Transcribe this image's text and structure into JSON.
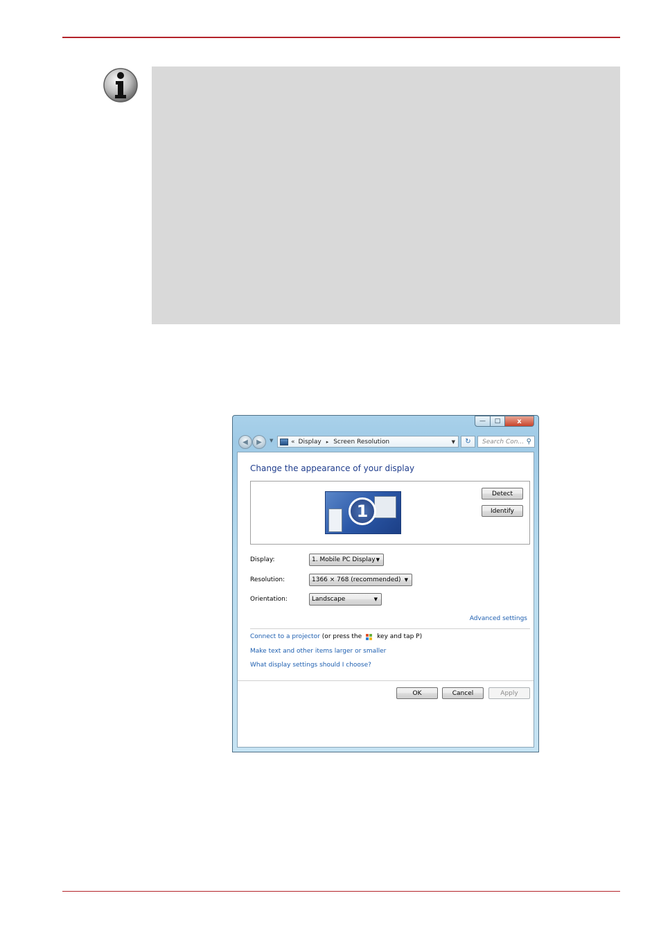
{
  "window": {
    "caption_buttons": {
      "minimize": "—",
      "maximize": "□",
      "close": "x"
    },
    "breadcrumb": {
      "overflow": "«",
      "item1": "Display",
      "separator": "▸",
      "item2": "Screen Resolution"
    },
    "search": {
      "placeholder": "Search Con..."
    }
  },
  "main": {
    "heading": "Change the appearance of your display",
    "monitor_number": "1",
    "detect_label": "Detect",
    "identify_label": "Identify",
    "display_label": "Display:",
    "display_value": "1. Mobile PC Display",
    "resolution_label": "Resolution:",
    "resolution_value": "1366 × 768 (recommended)",
    "orientation_label": "Orientation:",
    "orientation_value": "Landscape",
    "advanced_link": "Advanced settings",
    "projector_link": "Connect to a projector",
    "projector_text1": "(or press the",
    "projector_text2": "key and tap P)",
    "larger_link": "Make text and other items larger or smaller",
    "help_link": "What display settings should I choose?",
    "ok_label": "OK",
    "cancel_label": "Cancel",
    "apply_label": "Apply"
  },
  "colors": {
    "accent_rule": "#b3232a",
    "link": "#1e5fb0",
    "heading": "#1e3c8c"
  }
}
